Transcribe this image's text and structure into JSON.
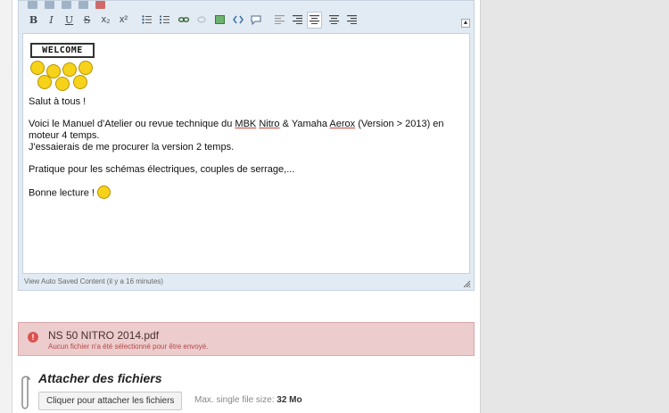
{
  "toolbar": {
    "bold": "B",
    "italic": "I",
    "underline": "U",
    "strike": "S",
    "subscript": "x₂",
    "superscript": "x²"
  },
  "editor": {
    "welcome_sign": "WELCOME",
    "greeting": "Salut à tous !",
    "para1_a": "Voici le Manuel d'Atelier ou revue technique du ",
    "para1_mbk": "MBK",
    "para1_sp1": " ",
    "para1_nitro": "Nitro",
    "para1_b": " & Yamaha ",
    "para1_aerox": "Aerox",
    "para1_c": " (Version > 2013) en moteur 4 temps.",
    "para1_line2": "J'essaierais de me procurer la version 2 temps.",
    "para2": "Pratique pour les schémas électriques, couples de serrage,...",
    "closing": "Bonne lecture ! ",
    "autosave": "View Auto Saved Content (il y a 16 minutes)"
  },
  "upload_error": {
    "filename": "NS 50 NITRO 2014.pdf",
    "message": "Aucun fichier n'a été sélectionné pour être envoyé.",
    "icon_glyph": "!"
  },
  "attach": {
    "title": "Attacher des fichiers",
    "button": "Cliquer pour attacher les fichiers",
    "max_label": "Max. single file size: ",
    "max_value": "32 Mo"
  },
  "icons": [
    "bold-icon",
    "italic-icon",
    "underline-icon",
    "strike-icon",
    "subscript-icon",
    "superscript-icon",
    "bullet-list-icon",
    "numbered-list-icon",
    "link-icon",
    "unlink-icon",
    "image-icon",
    "code-icon",
    "quote-icon",
    "align-left-icon",
    "align-center-icon",
    "align-right-icon"
  ],
  "colors": {
    "error_bg": "#eccccc",
    "error_text": "#b44848",
    "editor_frame": "#e2ebf3"
  }
}
